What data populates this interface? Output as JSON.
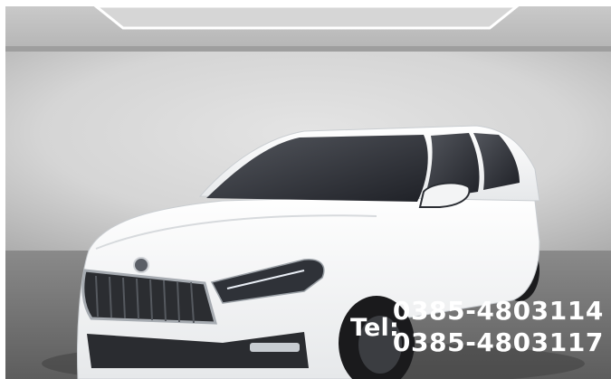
{
  "image": {
    "subject": "white hatchback car in a showroom",
    "colors": {
      "wall": "#d8d8d8",
      "floor": "#777777",
      "ceiling": "#bfbfbf",
      "car_body": "#f5f5f5",
      "glass": "#2a2d33"
    }
  },
  "overlay": {
    "tel_label": "Tel:",
    "phone_1": "0385-4803114",
    "phone_2": "0385-4803117"
  }
}
